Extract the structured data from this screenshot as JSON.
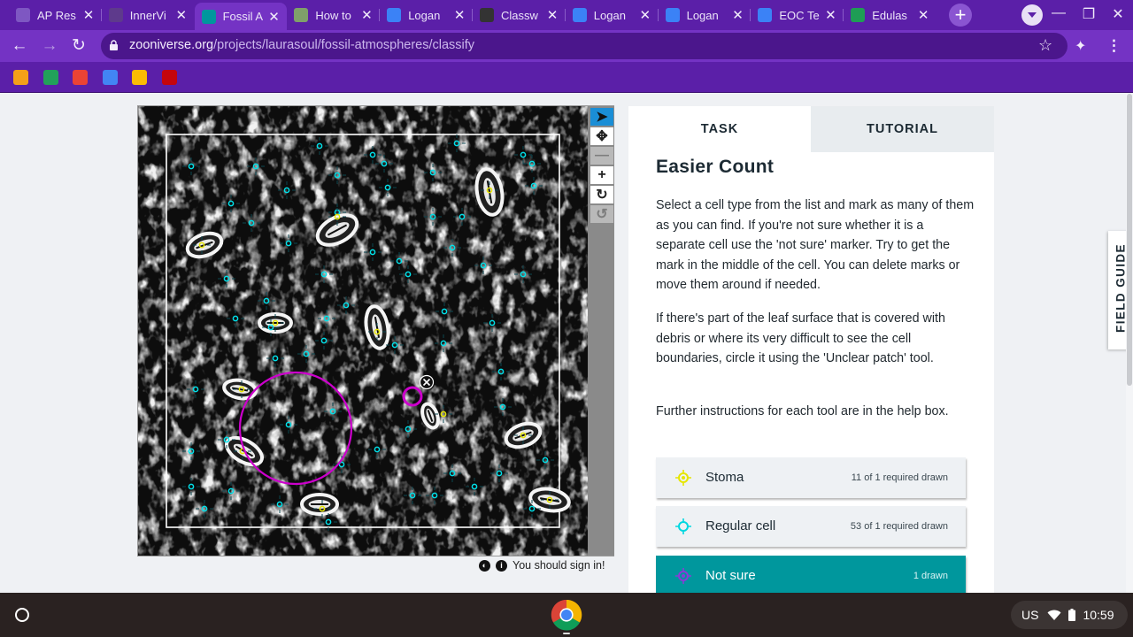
{
  "browser": {
    "tabs": [
      {
        "title": "AP Res",
        "favicon": "list-icon",
        "color": "#7e57c2",
        "active": false
      },
      {
        "title": "InnerVi",
        "favicon": "innerview-icon",
        "color": "#5e3a8c",
        "active": false
      },
      {
        "title": "Fossil A",
        "favicon": "zooniverse-icon",
        "color": "#00979d",
        "active": true
      },
      {
        "title": "How to",
        "favicon": "butterfly-icon",
        "color": "#7fa06a",
        "active": false
      },
      {
        "title": "Logan",
        "favicon": "docs-icon",
        "color": "#3b82f6",
        "active": false
      },
      {
        "title": "Classw",
        "favicon": "classroom-icon",
        "color": "#333333",
        "active": false
      },
      {
        "title": "Logan",
        "favicon": "docs-icon",
        "color": "#3b82f6",
        "active": false
      },
      {
        "title": "Logan",
        "favicon": "docs-icon",
        "color": "#3b82f6",
        "active": false
      },
      {
        "title": "EOC Te",
        "favicon": "docs-icon",
        "color": "#3b82f6",
        "active": false
      },
      {
        "title": "Edulas",
        "favicon": "edulastic-icon",
        "color": "#1f9d55",
        "active": false
      }
    ],
    "url_host": "zooniverse.org",
    "url_path": "/projects/laurasoul/fossil-atmospheres/classify",
    "bookmarks": [
      {
        "name": "apps-bookmark-icon",
        "color": "#f4a018"
      },
      {
        "name": "classroom-bookmark-icon",
        "color": "#22a15a"
      },
      {
        "name": "gmail-bookmark-icon",
        "color": "#ea4335"
      },
      {
        "name": "docs-bookmark-icon",
        "color": "#4285f4"
      },
      {
        "name": "drive-bookmark-icon",
        "color": "#fbbc04"
      },
      {
        "name": "uw-bookmark-icon",
        "color": "#c5050c"
      }
    ]
  },
  "subject": {
    "sign_in_notice": "You should sign in!",
    "toolbar": [
      "pointer-tool",
      "pan-tool",
      "zoom-out-tool",
      "zoom-in-tool",
      "rotate-tool",
      "reset-tool"
    ]
  },
  "task_panel": {
    "tab_task": "TASK",
    "tab_tutorial": "TUTORIAL",
    "title": "Easier Count",
    "instructions": [
      "Select a cell type from the list and mark as many of them as you can find. If you're not sure whether it is a separate cell use the 'not sure' marker. Try to get the mark in the middle of the cell. You can delete marks or move them around if needed.",
      "If there's part of the leaf surface that is covered with debris or where its very difficult to see the cell boundaries, circle it using the 'Unclear patch' tool.",
      "Further instructions for each tool are in the help box."
    ],
    "tools": [
      {
        "label": "Stoma",
        "count": "11 of 1 required drawn",
        "icon": "stoma-marker-icon",
        "color": "#e6e600",
        "selected": false
      },
      {
        "label": "Regular cell",
        "count": "53 of 1 required drawn",
        "icon": "regular-cell-marker-icon",
        "color": "#00d7e0",
        "selected": false
      },
      {
        "label": "Not sure",
        "count": "1 drawn",
        "icon": "not-sure-marker-icon",
        "color": "#8a3ad8",
        "selected": true
      }
    ]
  },
  "field_guide": "FIELD GUIDE",
  "shelf": {
    "locale": "US",
    "time": "10:59"
  },
  "colors": {
    "marker_stoma": "#e6e600",
    "marker_cell": "#00e1ea",
    "marker_unclear": "#cc00cc",
    "accent": "#00979d"
  }
}
